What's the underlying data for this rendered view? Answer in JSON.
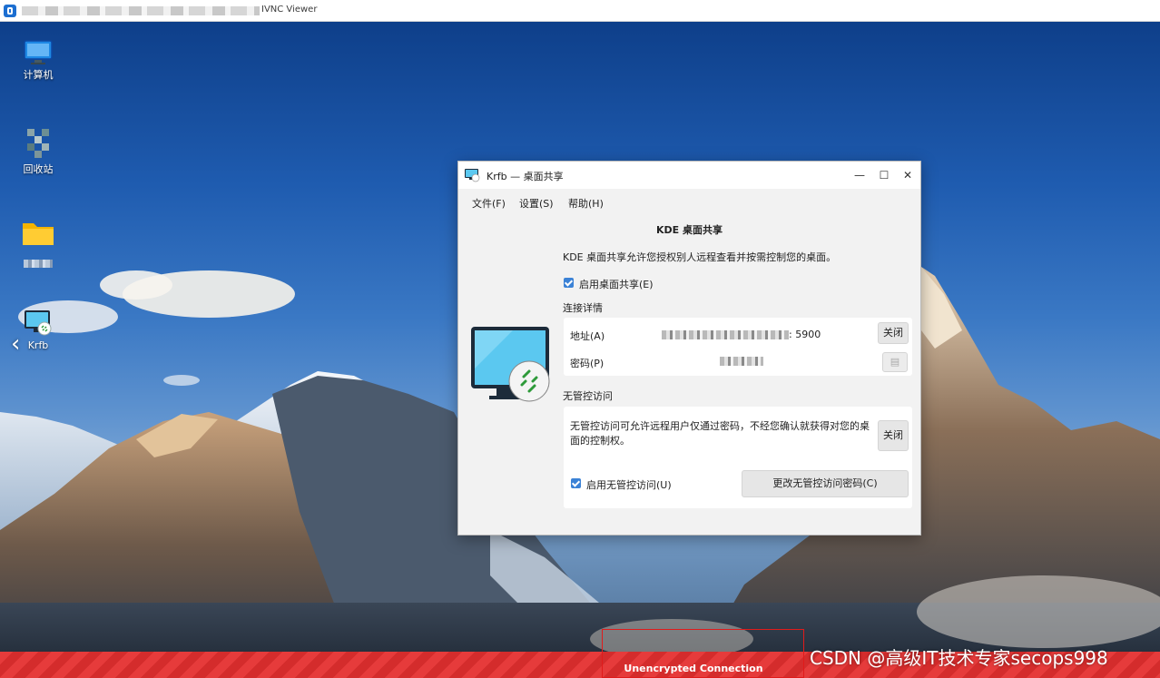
{
  "vnc": {
    "title": "IVNC Viewer"
  },
  "desktop": {
    "icons": [
      {
        "label": "计算机"
      },
      {
        "label": "回收站"
      },
      {
        "label": "Krfb"
      }
    ]
  },
  "krfb": {
    "window_title": "Krfb — 桌面共享",
    "menu": [
      "文件(F)",
      "设置(S)",
      "帮助(H)"
    ],
    "heading": "KDE 桌面共享",
    "description": "KDE 桌面共享允许您授权别人远程查看并按需控制您的桌面。",
    "enable_sharing_label": "启用桌面共享(E)",
    "connection_section": "连接详情",
    "address_label": "地址(A)",
    "address_port": ": 5900",
    "password_label": "密码(P)",
    "close_label": "关闭",
    "unattended_section": "无管控访问",
    "unattended_desc": "无管控访问可允许远程用户仅通过密码，不经您确认就获得对您的桌面的控制权。",
    "enable_unattended_label": "启用无管控访问(U)",
    "change_password_label": "更改无管控访问密码(C)"
  },
  "banner": {
    "text": "Unencrypted Connection"
  },
  "watermark": "CSDN @高级IT技术专家secops998",
  "colors": {
    "accent": "#3b82d6",
    "banner_red": "#e63b3b",
    "vnc_blue": "#1d6fd1"
  }
}
